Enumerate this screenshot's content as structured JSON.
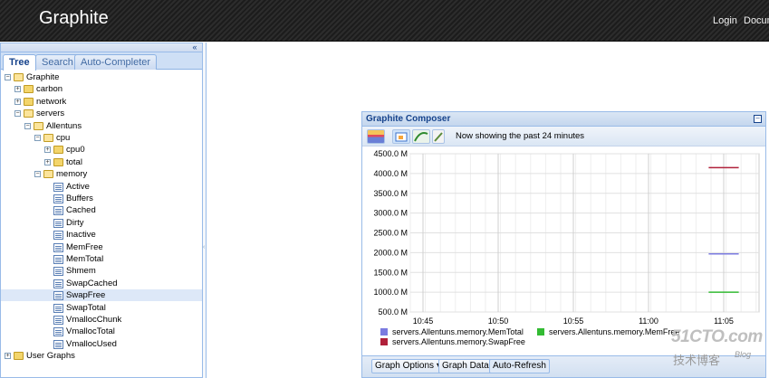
{
  "header": {
    "brand": "Graphite",
    "login": "Login",
    "docs": "Docum"
  },
  "left_panel": {
    "collapse_glyph": "«",
    "tabs": [
      "Tree",
      "Search",
      "Auto-Completer"
    ],
    "active_tab": "Tree",
    "tree": [
      {
        "label": "Graphite",
        "depth": 0,
        "type": "folder",
        "state": "open"
      },
      {
        "label": "carbon",
        "depth": 1,
        "type": "folder",
        "state": "closed"
      },
      {
        "label": "network",
        "depth": 1,
        "type": "folder",
        "state": "closed"
      },
      {
        "label": "servers",
        "depth": 1,
        "type": "folder",
        "state": "open"
      },
      {
        "label": "Allentuns",
        "depth": 2,
        "type": "folder",
        "state": "open"
      },
      {
        "label": "cpu",
        "depth": 3,
        "type": "folder",
        "state": "open"
      },
      {
        "label": "cpu0",
        "depth": 4,
        "type": "folder",
        "state": "closed"
      },
      {
        "label": "total",
        "depth": 4,
        "type": "folder",
        "state": "closed"
      },
      {
        "label": "memory",
        "depth": 3,
        "type": "folder",
        "state": "open"
      },
      {
        "label": "Active",
        "depth": 4,
        "type": "leaf"
      },
      {
        "label": "Buffers",
        "depth": 4,
        "type": "leaf"
      },
      {
        "label": "Cached",
        "depth": 4,
        "type": "leaf"
      },
      {
        "label": "Dirty",
        "depth": 4,
        "type": "leaf"
      },
      {
        "label": "Inactive",
        "depth": 4,
        "type": "leaf"
      },
      {
        "label": "MemFree",
        "depth": 4,
        "type": "leaf"
      },
      {
        "label": "MemTotal",
        "depth": 4,
        "type": "leaf"
      },
      {
        "label": "Shmem",
        "depth": 4,
        "type": "leaf"
      },
      {
        "label": "SwapCached",
        "depth": 4,
        "type": "leaf"
      },
      {
        "label": "SwapFree",
        "depth": 4,
        "type": "leaf",
        "selected": true
      },
      {
        "label": "SwapTotal",
        "depth": 4,
        "type": "leaf"
      },
      {
        "label": "VmallocChunk",
        "depth": 4,
        "type": "leaf"
      },
      {
        "label": "VmallocTotal",
        "depth": 4,
        "type": "leaf"
      },
      {
        "label": "VmallocUsed",
        "depth": 4,
        "type": "leaf"
      },
      {
        "label": "User Graphs",
        "depth": 0,
        "type": "folder",
        "state": "closed"
      }
    ]
  },
  "composer": {
    "title": "Graphite Composer",
    "status": "Now showing the past 24 minutes",
    "toolbar_icons": [
      "graph-options-icon",
      "image-icon",
      "refresh-graph-icon",
      "edit-icon"
    ],
    "buttons": {
      "graph_options": "Graph Options ▾",
      "graph_data": "Graph Data",
      "auto_refresh": "Auto-Refresh"
    }
  },
  "chart_data": {
    "type": "line",
    "x_ticks": [
      "10:45",
      "10:50",
      "10:55",
      "11:00",
      "11:05"
    ],
    "y_ticks": [
      "4500.0 M",
      "4000.0 M",
      "3500.0 M",
      "3000.0 M",
      "2500.0 M",
      "2000.0 M",
      "1500.0 M",
      "1000.0 M",
      "500.0 M"
    ],
    "ylim": [
      500,
      4500
    ],
    "grid": true,
    "legend_position": "bottom",
    "series": [
      {
        "name": "servers.Allentuns.memory.MemTotal",
        "color": "#7b7be0",
        "x": [
          "11:04",
          "11:06"
        ],
        "values": [
          1970,
          1970
        ]
      },
      {
        "name": "servers.Allentuns.memory.MemFree",
        "color": "#33bb33",
        "x": [
          "11:04",
          "11:06"
        ],
        "values": [
          1000,
          1000
        ]
      },
      {
        "name": "servers.Allentuns.memory.SwapFree",
        "color": "#b0203a",
        "x": [
          "11:04",
          "11:06"
        ],
        "values": [
          4150,
          4150
        ]
      }
    ]
  },
  "watermark": {
    "line1": "51CTO.com",
    "line2": "技术博客",
    "line3": "Blog"
  },
  "colors": {
    "panel_border": "#99bbe8",
    "title_text": "#15428b"
  }
}
